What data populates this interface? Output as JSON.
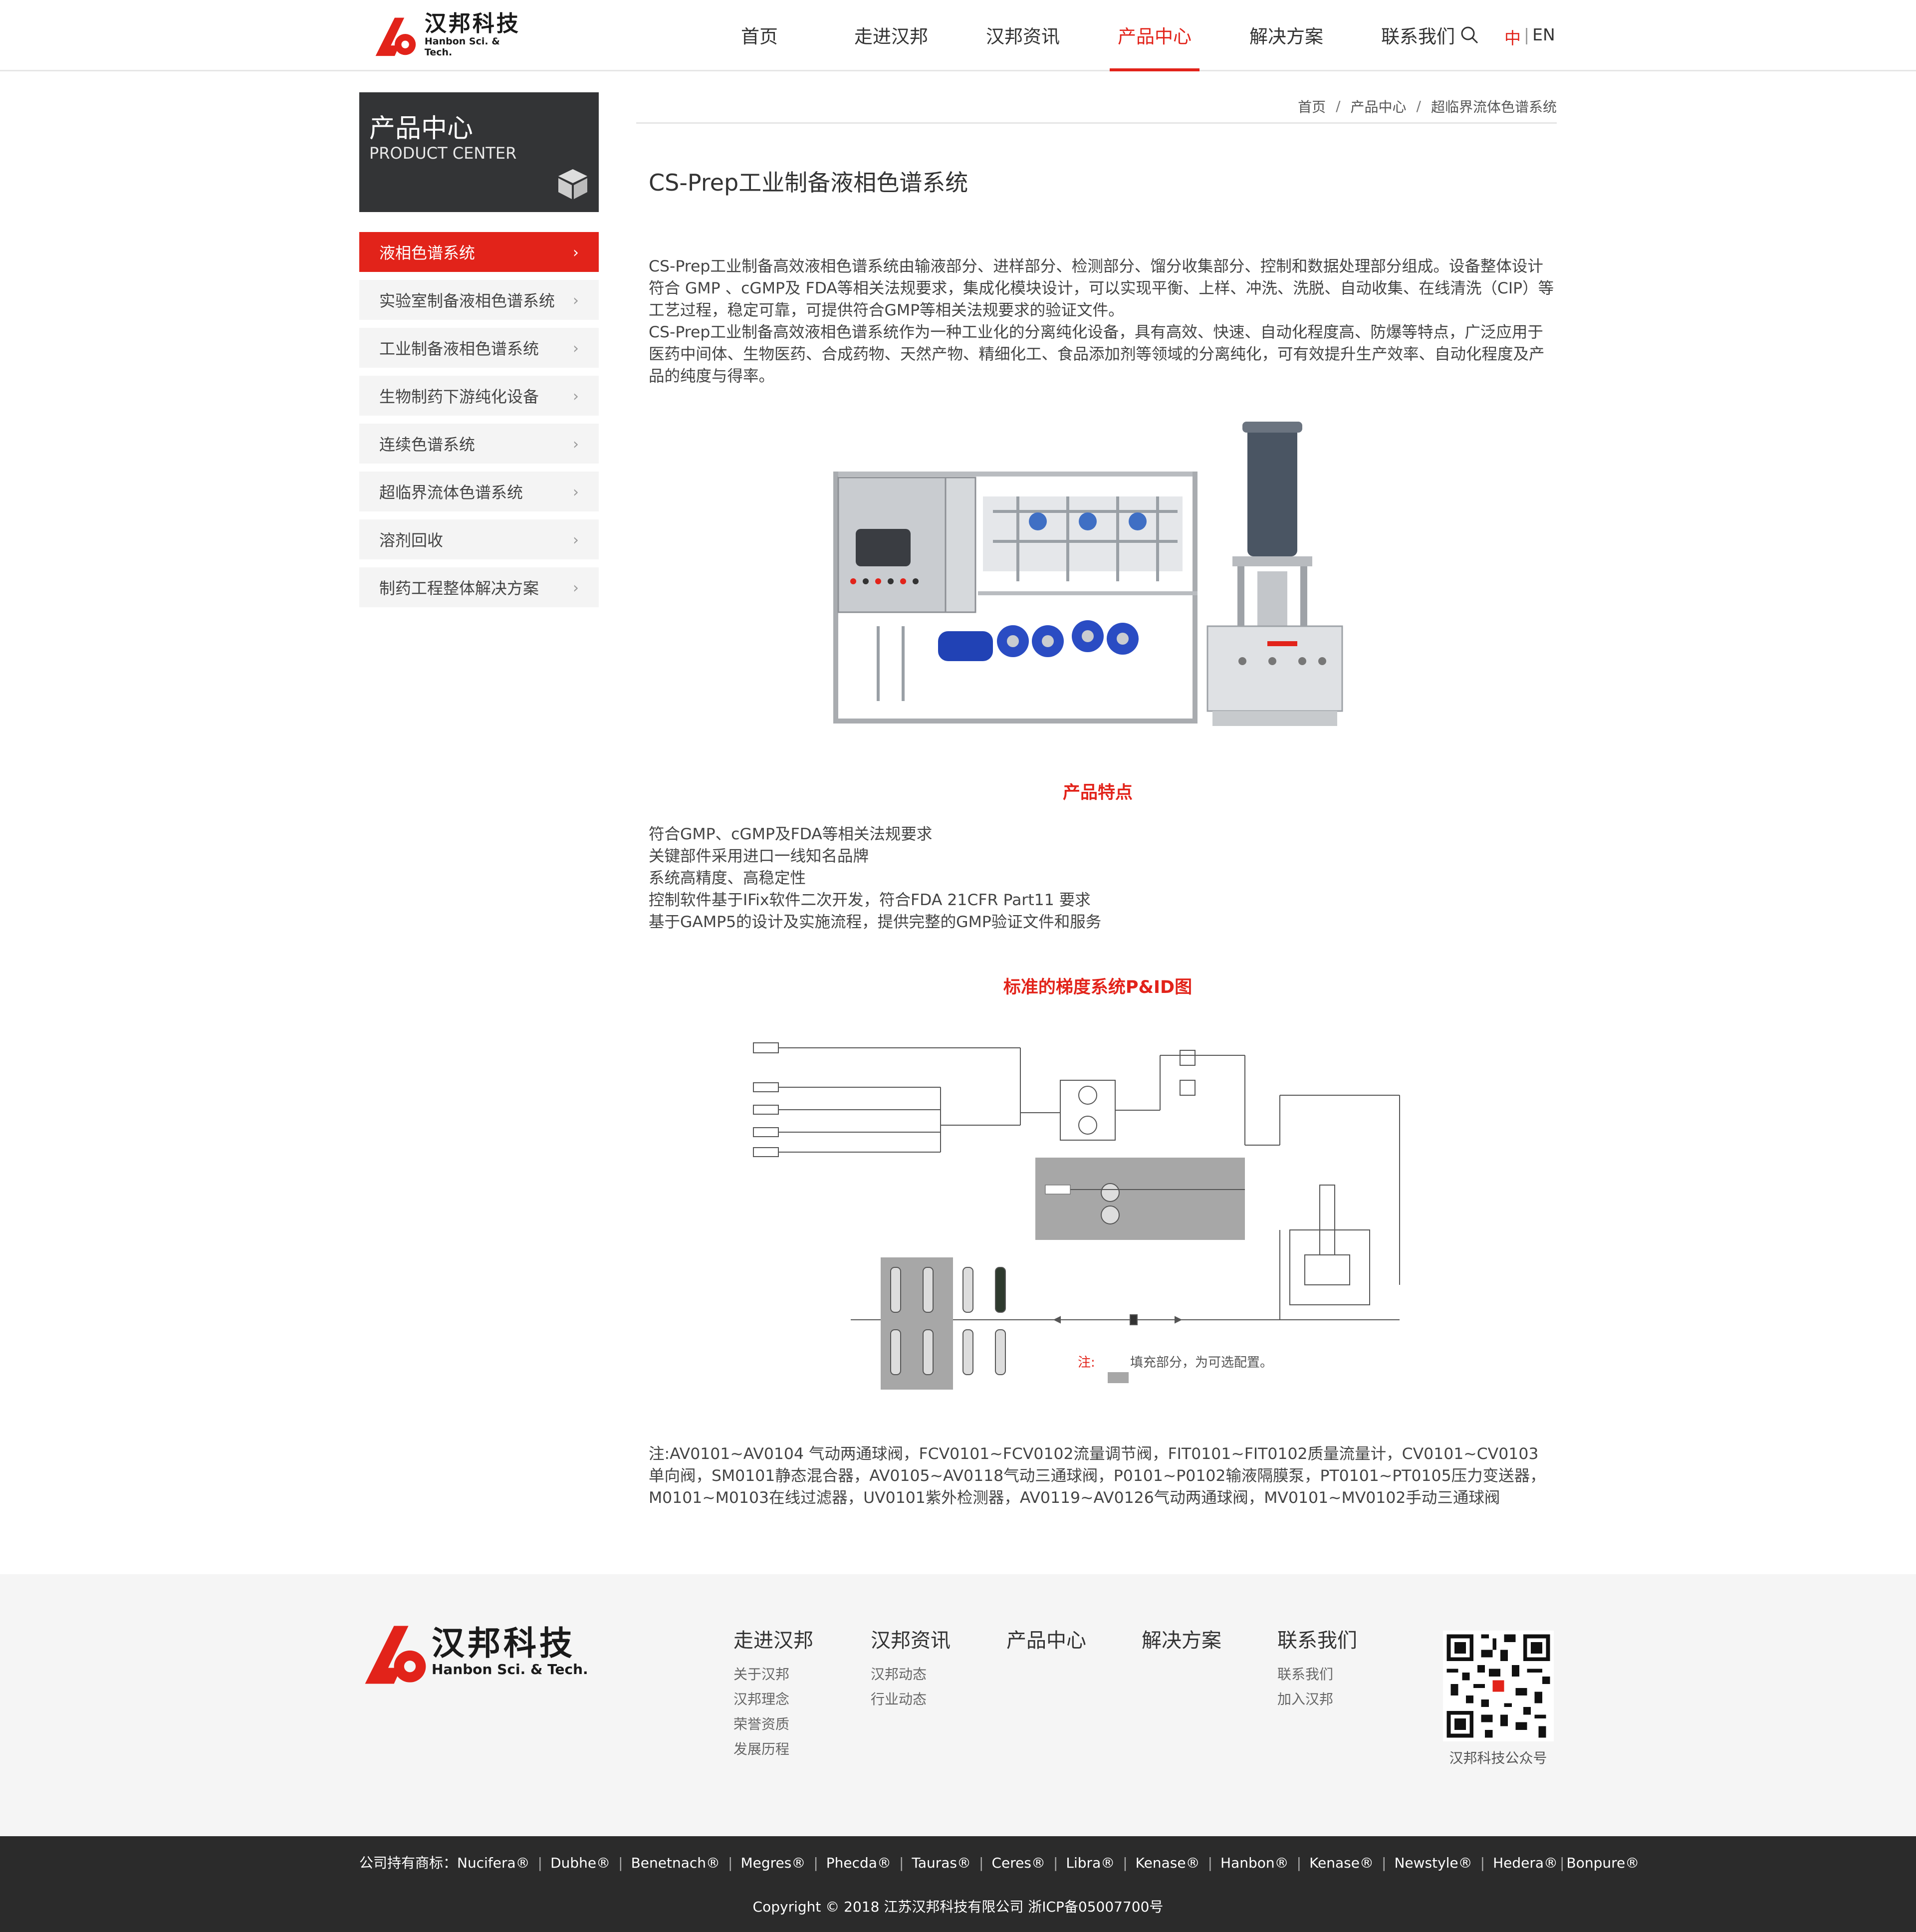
{
  "brand": {
    "name_cn": "汉邦科技",
    "name_en": "Hanbon Sci. & Tech.",
    "accent": "#e2231a"
  },
  "nav": {
    "items": [
      "首页",
      "走进汉邦",
      "汉邦资讯",
      "产品中心",
      "解决方案",
      "联系我们"
    ],
    "active": "产品中心",
    "lang_zh": "中",
    "lang_sep": "|",
    "lang_en": "EN"
  },
  "sidebar": {
    "title_cn": "产品中心",
    "title_en": "PRODUCT CENTER",
    "items": [
      "液相色谱系统",
      "实验室制备液相色谱系统",
      "工业制备液相色谱系统",
      "生物制药下游纯化设备",
      "连续色谱系统",
      "超临界流体色谱系统",
      "溶剂回收",
      "制药工程整体解决方案"
    ],
    "active_index": 0
  },
  "breadcrumb": {
    "items": [
      "首页",
      "产品中心",
      "超临界流体色谱系统"
    ],
    "sep": "/"
  },
  "main": {
    "title": "CS-Prep工业制备液相色谱系统",
    "intro1": "CS-Prep工业制备高效液相色谱系统由输液部分、进样部分、检测部分、馏分收集部分、控制和数据处理部分组成。设备整体设计符合 GMP 、cGMP及 FDA等相关法规要求，集成化模块设计，可以实现平衡、上样、冲洗、洗脱、自动收集、在线清洗（CIP）等工艺过程，稳定可靠，可提供符合GMP等相关法规要求的验证文件。",
    "intro2": "CS-Prep工业制备高效液相色谱系统作为一种工业化的分离纯化设备，具有高效、快速、自动化程度高、防爆等特点，广泛应用于医药中间体、生物医药、合成药物、天然产物、精细化工、食品添加剂等领域的分离纯化，可有效提升生产效率、自动化程度及产品的纯度与得率。",
    "features_title": "产品特点",
    "features": [
      "符合GMP、cGMP及FDA等相关法规要求",
      "关键部件采用进口一线知名品牌",
      "系统高精度、高稳定性",
      "控制软件基于IFix软件二次开发，符合FDA 21CFR Part11 要求",
      "基于GAMP5的设计及实施流程，提供完整的GMP验证文件和服务"
    ],
    "pid_title": "标准的梯度系统P&ID图",
    "pid_note_label": "注:",
    "pid_note_text": "填充部分，为可选配置。",
    "note": "注:AV0101~AV0104 气动两通球阀，FCV0101~FCV0102流量调节阀，FIT0101~FIT0102质量流量计，CV0101~CV0103单向阀，SM0101静态混合器，AV0105~AV0118气动三通球阀，P0101~P0102输液隔膜泵，PT0101~PT0105压力变送器，M0101~M0103在线过滤器，UV0101紫外检测器，AV0119~AV0126气动两通球阀，MV0101~MV0102手动三通球阀"
  },
  "footer": {
    "columns": [
      {
        "title": "走进汉邦",
        "links": [
          "关于汉邦",
          "汉邦理念",
          "荣誉资质",
          "发展历程"
        ]
      },
      {
        "title": "汉邦资讯",
        "links": [
          "汉邦动态",
          "行业动态"
        ]
      },
      {
        "title": "产品中心",
        "links": []
      },
      {
        "title": "解决方案",
        "links": []
      },
      {
        "title": "联系我们",
        "links": [
          "联系我们",
          "加入汉邦"
        ]
      }
    ],
    "qr_caption": "汉邦科技公众号",
    "trademarks_label": "公司持有商标：",
    "trademarks": [
      "Nucifera®",
      "Dubhe®",
      "Benetnach®",
      "Megres®",
      "Phecda®",
      "Tauras®",
      "Ceres®",
      "Libra®",
      "Kenase®",
      "Hanbon®",
      "Kenase®",
      "Newstyle®",
      "Hedera®",
      "Bonpure®"
    ],
    "copyright": "Copyright © 2018 江苏汉邦科技有限公司 浙ICP备05007700号"
  }
}
